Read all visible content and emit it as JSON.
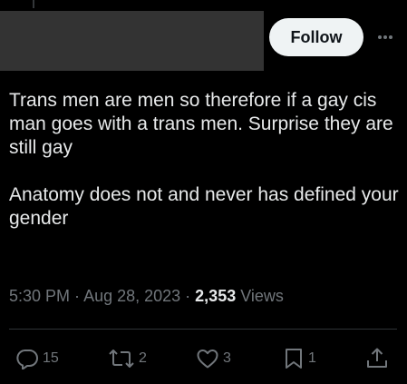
{
  "header": {
    "follow_label": "Follow",
    "more_icon": "more-horizontal-icon"
  },
  "tweet": {
    "paragraphs": [
      "Trans men are men so therefore if a gay cis man goes with a trans men. Surprise they are still gay",
      "Anatomy does not and never has defined your gender"
    ],
    "time": "5:30 PM",
    "date": "Aug 28, 2023",
    "views_count": "2,353",
    "views_label": "Views"
  },
  "actions": {
    "reply": {
      "icon": "reply-icon",
      "count": "15"
    },
    "retweet": {
      "icon": "retweet-icon",
      "count": "2"
    },
    "like": {
      "icon": "heart-icon",
      "count": "3"
    },
    "bookmark": {
      "icon": "bookmark-icon",
      "count": "1"
    },
    "share": {
      "icon": "share-icon"
    }
  },
  "colors": {
    "background": "#000000",
    "text": "#e7e9ea",
    "muted": "#71767b",
    "divider": "#2f3336",
    "follow_bg": "#eff3f4",
    "follow_text": "#0f1419"
  }
}
